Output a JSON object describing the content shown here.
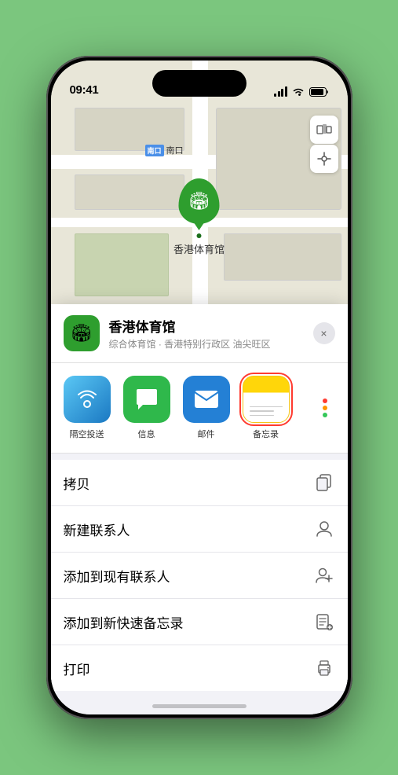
{
  "status_bar": {
    "time": "09:41",
    "location_arrow": "▲"
  },
  "map": {
    "label_prefix": "南口",
    "label_code": "南口",
    "stadium_name": "香港体育馆",
    "stadium_category": "综合体育馆 · 香港特别行政区 油尖旺区"
  },
  "share_apps": [
    {
      "id": "airdrop",
      "label": "隔空投送",
      "type": "airdrop"
    },
    {
      "id": "messages",
      "label": "信息",
      "type": "messages"
    },
    {
      "id": "mail",
      "label": "邮件",
      "type": "mail"
    },
    {
      "id": "notes",
      "label": "备忘录",
      "type": "notes",
      "selected": true
    }
  ],
  "actions": [
    {
      "label": "拷贝",
      "icon": "copy"
    },
    {
      "label": "新建联系人",
      "icon": "person-add"
    },
    {
      "label": "添加到现有联系人",
      "icon": "person-plus"
    },
    {
      "label": "添加到新快速备忘录",
      "icon": "note-add"
    },
    {
      "label": "打印",
      "icon": "print"
    }
  ],
  "close_label": "×",
  "dot_colors": [
    "#ff3b30",
    "#ff9500",
    "#ffcc00",
    "#34c759",
    "#007aff",
    "#5856d6"
  ]
}
